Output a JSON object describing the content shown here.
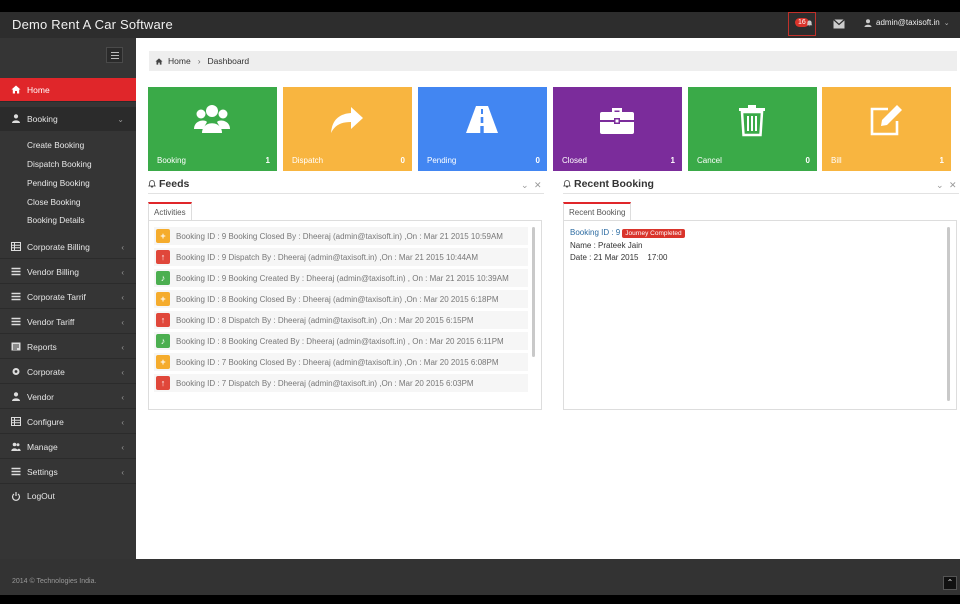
{
  "app": {
    "title": "Demo Rent A Car Software"
  },
  "header": {
    "notification_count": "16",
    "user_label": "admin@taxisoft.in"
  },
  "sidebar": {
    "items": [
      {
        "label": "Home"
      },
      {
        "label": "Booking"
      },
      {
        "label": "Corporate Billing"
      },
      {
        "label": "Vendor Billing"
      },
      {
        "label": "Corporate Tarrif"
      },
      {
        "label": "Vendor Tariff"
      },
      {
        "label": "Reports"
      },
      {
        "label": "Corporate"
      },
      {
        "label": "Vendor"
      },
      {
        "label": "Configure"
      },
      {
        "label": "Manage"
      },
      {
        "label": "Settings"
      },
      {
        "label": "LogOut"
      }
    ],
    "booking_sub": [
      {
        "label": "Create Booking"
      },
      {
        "label": "Dispatch Booking"
      },
      {
        "label": "Pending Booking"
      },
      {
        "label": "Close Booking"
      },
      {
        "label": "Booking Details"
      }
    ]
  },
  "breadcrumb": {
    "home": "Home",
    "current": "Dashboard"
  },
  "tiles": [
    {
      "label": "Booking",
      "count": "1",
      "color": "#3aaa48"
    },
    {
      "label": "Dispatch",
      "count": "0",
      "color": "#f8b540"
    },
    {
      "label": "Pending",
      "count": "0",
      "color": "#4286f2"
    },
    {
      "label": "Closed",
      "count": "1",
      "color": "#7b2c9b"
    },
    {
      "label": "Cancel",
      "count": "0",
      "color": "#3aaa48"
    },
    {
      "label": "Bill",
      "count": "1",
      "color": "#f8b540"
    }
  ],
  "feeds": {
    "title": "Feeds",
    "tab": "Activities",
    "rows": [
      {
        "type": "plus",
        "color": "#f5ac2d",
        "text": "Booking ID : 9 Booking Closed By : Dheeraj (admin@taxisoft.in) ,On : Mar 21 2015 10:59AM"
      },
      {
        "type": "dispatch",
        "color": "#e0473a",
        "text": "Booking ID : 9 Dispatch By : Dheeraj (admin@taxisoft.in) ,On : Mar 21 2015 10:44AM"
      },
      {
        "type": "created",
        "color": "#4caf50",
        "text": "Booking ID : 9 Booking Created By : Dheeraj (admin@taxisoft.in) , On : Mar 21 2015 10:39AM"
      },
      {
        "type": "plus",
        "color": "#f5ac2d",
        "text": "Booking ID : 8 Booking Closed By : Dheeraj (admin@taxisoft.in) ,On : Mar 20 2015 6:18PM"
      },
      {
        "type": "dispatch",
        "color": "#e0473a",
        "text": "Booking ID : 8 Dispatch By : Dheeraj (admin@taxisoft.in) ,On : Mar 20 2015 6:15PM"
      },
      {
        "type": "created",
        "color": "#4caf50",
        "text": "Booking ID : 8 Booking Created By : Dheeraj (admin@taxisoft.in) , On : Mar 20 2015 6:11PM"
      },
      {
        "type": "plus",
        "color": "#f5ac2d",
        "text": "Booking ID : 7 Booking Closed By : Dheeraj (admin@taxisoft.in) ,On : Mar 20 2015 6:08PM"
      },
      {
        "type": "dispatch",
        "color": "#e0473a",
        "text": "Booking ID : 7 Dispatch By : Dheeraj (admin@taxisoft.in) ,On : Mar 20 2015 6:03PM"
      }
    ]
  },
  "recent": {
    "title": "Recent Booking",
    "tab": "Recent Booking",
    "booking_id": "Booking ID : 9",
    "status": "Journey Completed",
    "name": "Name : Prateek Jain",
    "date": "Date : 21 Mar 2015    17:00"
  },
  "footer": {
    "copyright": "2014 © Technologies India."
  }
}
